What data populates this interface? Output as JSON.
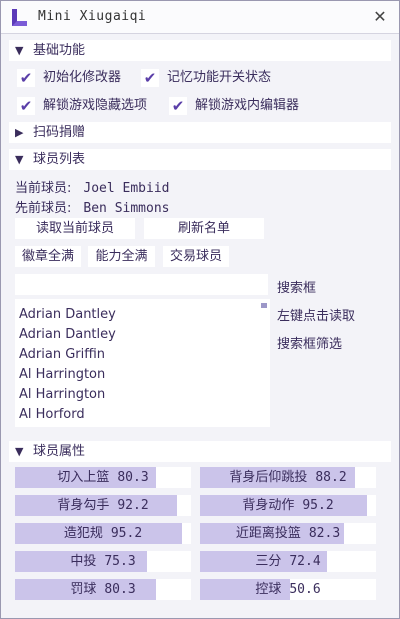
{
  "window": {
    "title": "Mini Xiugaiqi",
    "close_label": "✕"
  },
  "sections": {
    "basic": "基础功能",
    "scan": "扫码捐赠",
    "players": "球员列表",
    "attributes": "球员属性"
  },
  "checkboxes": [
    {
      "label": "初始化修改器",
      "checked": true
    },
    {
      "label": "记忆功能开关状态",
      "checked": true
    },
    {
      "label": "解锁游戏隐藏选项",
      "checked": true
    },
    {
      "label": "解锁游戏内编辑器",
      "checked": true
    }
  ],
  "current_player": {
    "label": "当前球员:",
    "value": "Joel Embiid"
  },
  "first_player": {
    "label": "先前球员:",
    "value": "Ben Simmons"
  },
  "buttons": {
    "read_current": "读取当前球员",
    "refresh_list": "刷新名单",
    "badges_full": "徽章全满",
    "abilities_full": "能力全满",
    "trade_player": "交易球员"
  },
  "search": {
    "placeholder": "",
    "label": "搜索框",
    "hint_click": "左键点击读取",
    "hint_filter": "搜索框筛选"
  },
  "player_list": [
    "Adrian Dantley",
    "Adrian Dantley",
    "Adrian Griffin",
    "Al Harrington",
    "Al Harrington",
    "Al Horford"
  ],
  "attributes": [
    {
      "name": "切入上篮",
      "value": "80.3",
      "fill": 0.8
    },
    {
      "name": "背身后仰跳投",
      "value": "88.2",
      "fill": 0.88
    },
    {
      "name": "背身勾手",
      "value": "92.2",
      "fill": 0.92
    },
    {
      "name": "背身动作",
      "value": "95.2",
      "fill": 0.95
    },
    {
      "name": "造犯规",
      "value": "95.2",
      "fill": 0.95
    },
    {
      "name": "近距离投篮",
      "value": "82.3",
      "fill": 0.82
    },
    {
      "name": "中投",
      "value": "75.3",
      "fill": 0.75
    },
    {
      "name": "三分",
      "value": "72.4",
      "fill": 0.72
    },
    {
      "name": "罚球",
      "value": "80.3",
      "fill": 0.8
    },
    {
      "name": "控球",
      "value": "50.6",
      "fill": 0.51
    }
  ],
  "icons": {
    "logo": "logo-icon",
    "collapse": "triangle-down-icon",
    "expand": "triangle-right-icon",
    "check": "check-icon"
  }
}
